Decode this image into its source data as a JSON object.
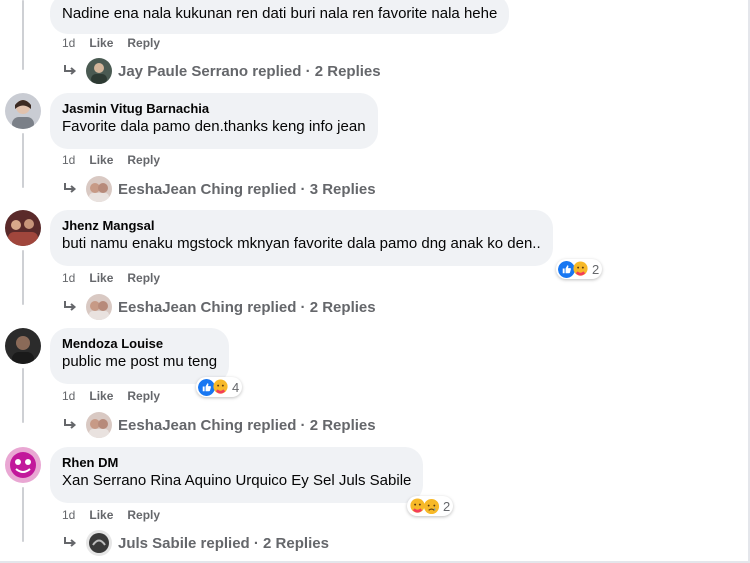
{
  "comments": [
    {
      "author": "",
      "text": "Nadine ena nala kukunan ren dati buri nala ren favorite nala hehe",
      "time": "1d",
      "like": "Like",
      "reply": "Reply",
      "replies": "Jay Paule Serrano replied · 2 Replies",
      "reaction_count": ""
    },
    {
      "author": "Jasmin Vitug Barnachia",
      "text": "Favorite dala pamo den.thanks keng info jean",
      "time": "1d",
      "like": "Like",
      "reply": "Reply",
      "replies": "EeshaJean Ching replied · 3 Replies",
      "reaction_count": ""
    },
    {
      "author": "Jhenz Mangsal",
      "text": "buti namu enaku mgstock mknyan favorite dala pamo dng anak ko den..",
      "time": "1d",
      "like": "Like",
      "reply": "Reply",
      "replies": "EeshaJean Ching replied · 2 Replies",
      "reaction_count": "2",
      "reaction_icons": [
        "like-icon",
        "care-icon"
      ]
    },
    {
      "author": "Mendoza Louise",
      "text": "public me post mu teng",
      "time": "1d",
      "like": "Like",
      "reply": "Reply",
      "replies": "EeshaJean Ching replied · 2 Replies",
      "reaction_count": "4",
      "reaction_icons": [
        "like-icon",
        "care-icon"
      ]
    },
    {
      "author": "Rhen DM",
      "text": "Xan Serrano Rina Aquino Urquico Ey Sel Juls Sabile",
      "time": "1d",
      "like": "Like",
      "reply": "Reply",
      "replies": "Juls Sabile replied · 2 Replies",
      "reaction_count": "2",
      "reaction_icons": [
        "care-icon",
        "sad-icon"
      ]
    }
  ],
  "colors": {
    "bubble": "#f0f2f5",
    "secondary_text": "#65676b",
    "like_blue": "#1877f2",
    "emoji_yellow": "#f7b928"
  }
}
